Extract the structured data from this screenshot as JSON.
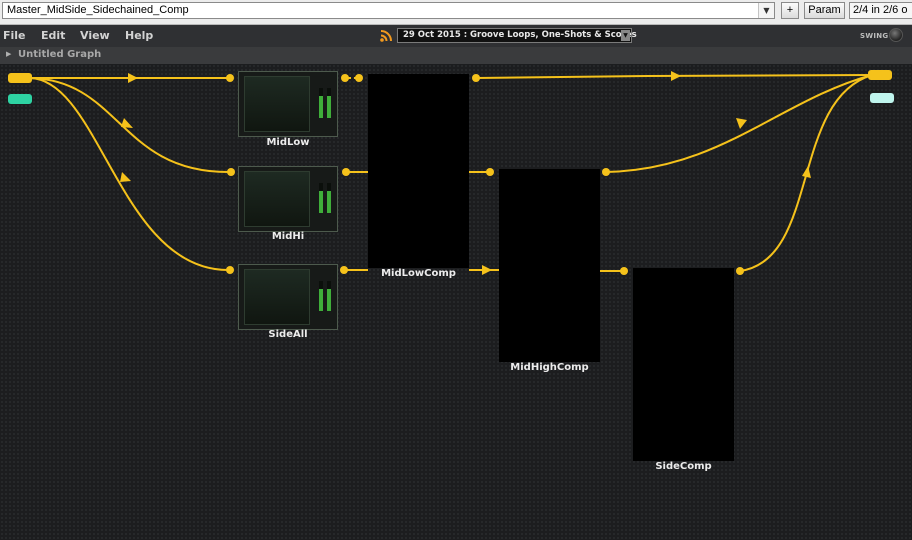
{
  "topbar": {
    "preset_name": "Master_MidSide_Sidechained_Comp",
    "add_label": "+",
    "param_label": "Param",
    "counter": "2/4 in 2/6 o"
  },
  "menu": {
    "items": [
      "File",
      "Edit",
      "View",
      "Help"
    ],
    "news": "29 Oct 2015 : Groove Loops, One-Shots & Scores",
    "swing_label": "SWING"
  },
  "graph": {
    "title": "Untitled Graph"
  },
  "nodes": {
    "midlow": "MidLow",
    "midhi": "MidHi",
    "sideall": "SideAll",
    "midlowcomp": "MidLowComp",
    "midhighcomp": "MidHighComp",
    "sidecomp": "SideComp"
  },
  "colors": {
    "wire": "#f5c21b",
    "pin_audio": "#f5c21b",
    "pin_midi_in": "#2ed3a3",
    "pin_midi_out": "#bff5ee"
  },
  "icons": {
    "rss": "rss-icon",
    "preset_dropdown": "chevron-down-icon",
    "news_dropdown": "chevron-down-icon",
    "graph_expand": "triangle-right-icon",
    "swing": "knob-icon"
  }
}
